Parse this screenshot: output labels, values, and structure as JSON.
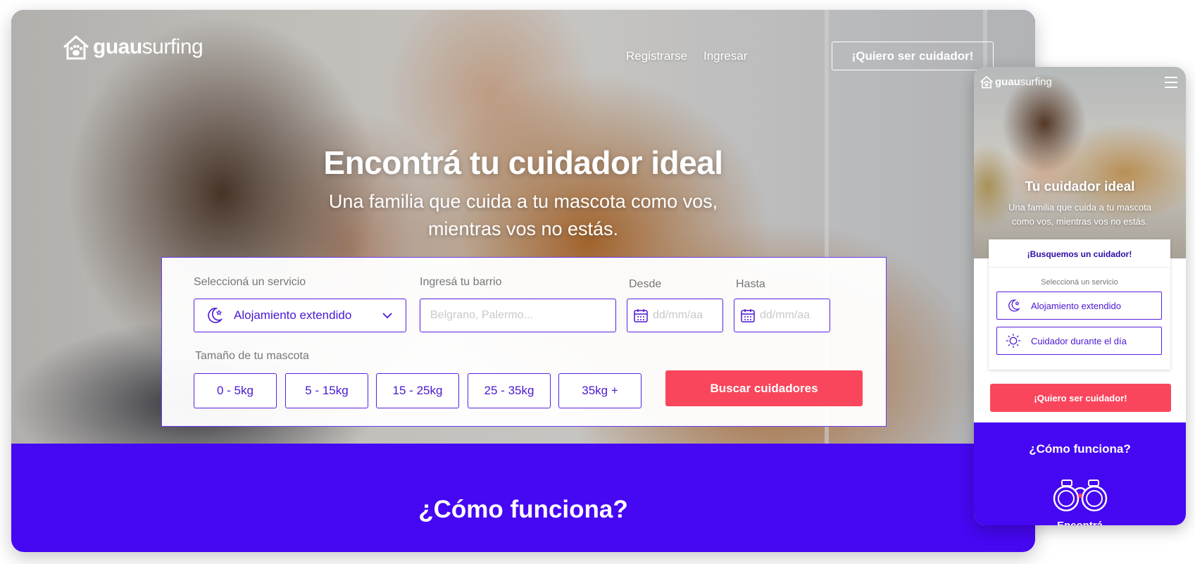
{
  "desktop": {
    "brand": {
      "bold": "guau",
      "light": "surfing"
    },
    "nav": {
      "register": "Registrarse",
      "login": "Ingresar",
      "cta": "¡Quiero ser cuidador!"
    },
    "hero": {
      "title": "Encontrá tu cuidador ideal",
      "subtitle": "Una familia que cuida a tu mascota como vos, mientras vos no estás."
    },
    "search": {
      "service_label": "Seleccioná un servicio",
      "service_value": "Alojamiento extendido",
      "barrio_label": "Ingresá tu barrio",
      "barrio_placeholder": "Belgrano, Palermo...",
      "from_label": "Desde",
      "from_placeholder": "dd/mm/aa",
      "to_label": "Hasta",
      "to_placeholder": "dd/mm/aa",
      "size_label": "Tamaño de tu mascota",
      "sizes": [
        "0 - 5kg",
        "5 - 15kg",
        "15 - 25kg",
        "25 - 35kg",
        "35kg +"
      ],
      "submit": "Buscar cuidadores"
    },
    "how": {
      "title": "¿Cómo funciona?"
    }
  },
  "mobile": {
    "brand": {
      "bold": "guau",
      "light": "surfing"
    },
    "hero": {
      "title": "Tu cuidador ideal",
      "subtitle": "Una familia que cuida a tu mascota como vos, mientras vos no estás."
    },
    "card": {
      "title": "¡Busquemos un cuidador!",
      "service_label": "Seleccioná un servicio",
      "options": [
        "Alojamiento extendido",
        "Cuidador durante el día"
      ]
    },
    "cta": "¡Quiero ser cuidador!",
    "how": {
      "title": "¿Cómo funciona?",
      "step": "Encontrá"
    }
  },
  "colors": {
    "primary": "#4607f2",
    "accent": "#f9465c",
    "input_border": "#5a1fe0",
    "input_text": "#4a17d2"
  },
  "icons": [
    "house-paw-icon",
    "moon-star-icon",
    "chevron-down-icon",
    "calendar-icon",
    "sun-icon",
    "menu-icon",
    "binoculars-icon"
  ]
}
